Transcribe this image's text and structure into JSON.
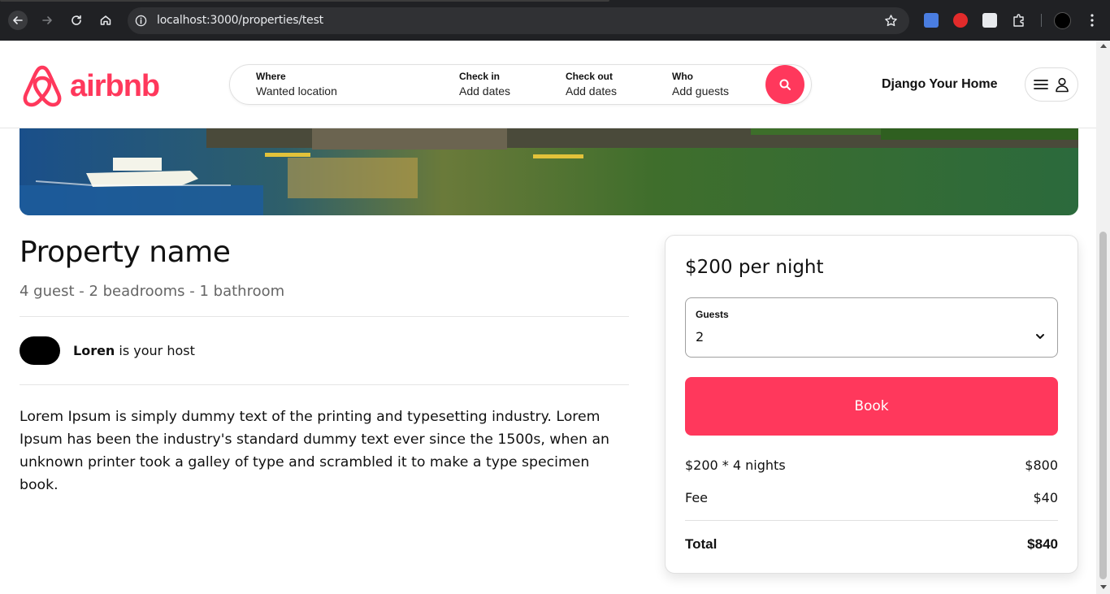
{
  "browser": {
    "url": "localhost:3000/properties/test",
    "icons": {
      "back": "arrow-left-icon",
      "forward": "arrow-right-icon",
      "reload": "reload-icon",
      "home": "home-icon",
      "info": "info-icon",
      "bookmark": "star-icon",
      "menu": "kebab-menu-icon"
    }
  },
  "header": {
    "logo_text": "airbnb",
    "search": {
      "where_label": "Where",
      "where_value": "Wanted location",
      "checkin_label": "Check in",
      "checkin_value": "Add dates",
      "checkout_label": "Check out",
      "checkout_value": "Add dates",
      "who_label": "Who",
      "who_value": "Add guests"
    },
    "host_link": "Django Your Home",
    "brand_color": "#ff385c"
  },
  "property": {
    "name": "Property name",
    "details": "4 guest - 2 beadrooms - 1 bathroom",
    "host_name": "Loren",
    "host_suffix": " is your host",
    "description": "Lorem Ipsum is simply dummy text of the printing and typesetting industry. Lorem Ipsum has been the industry's standard dummy text ever since the 1500s, when an unknown printer took a galley of type and scrambled it to make a type specimen book."
  },
  "booking": {
    "price": "$200 per night",
    "guests_label": "Guests",
    "guests_value": "2",
    "book_label": "Book",
    "nights_label": "$200 * 4 nights",
    "nights_amount": "$800",
    "fee_label": "Fee",
    "fee_amount": "$40",
    "total_label": "Total",
    "total_amount": "$840"
  }
}
